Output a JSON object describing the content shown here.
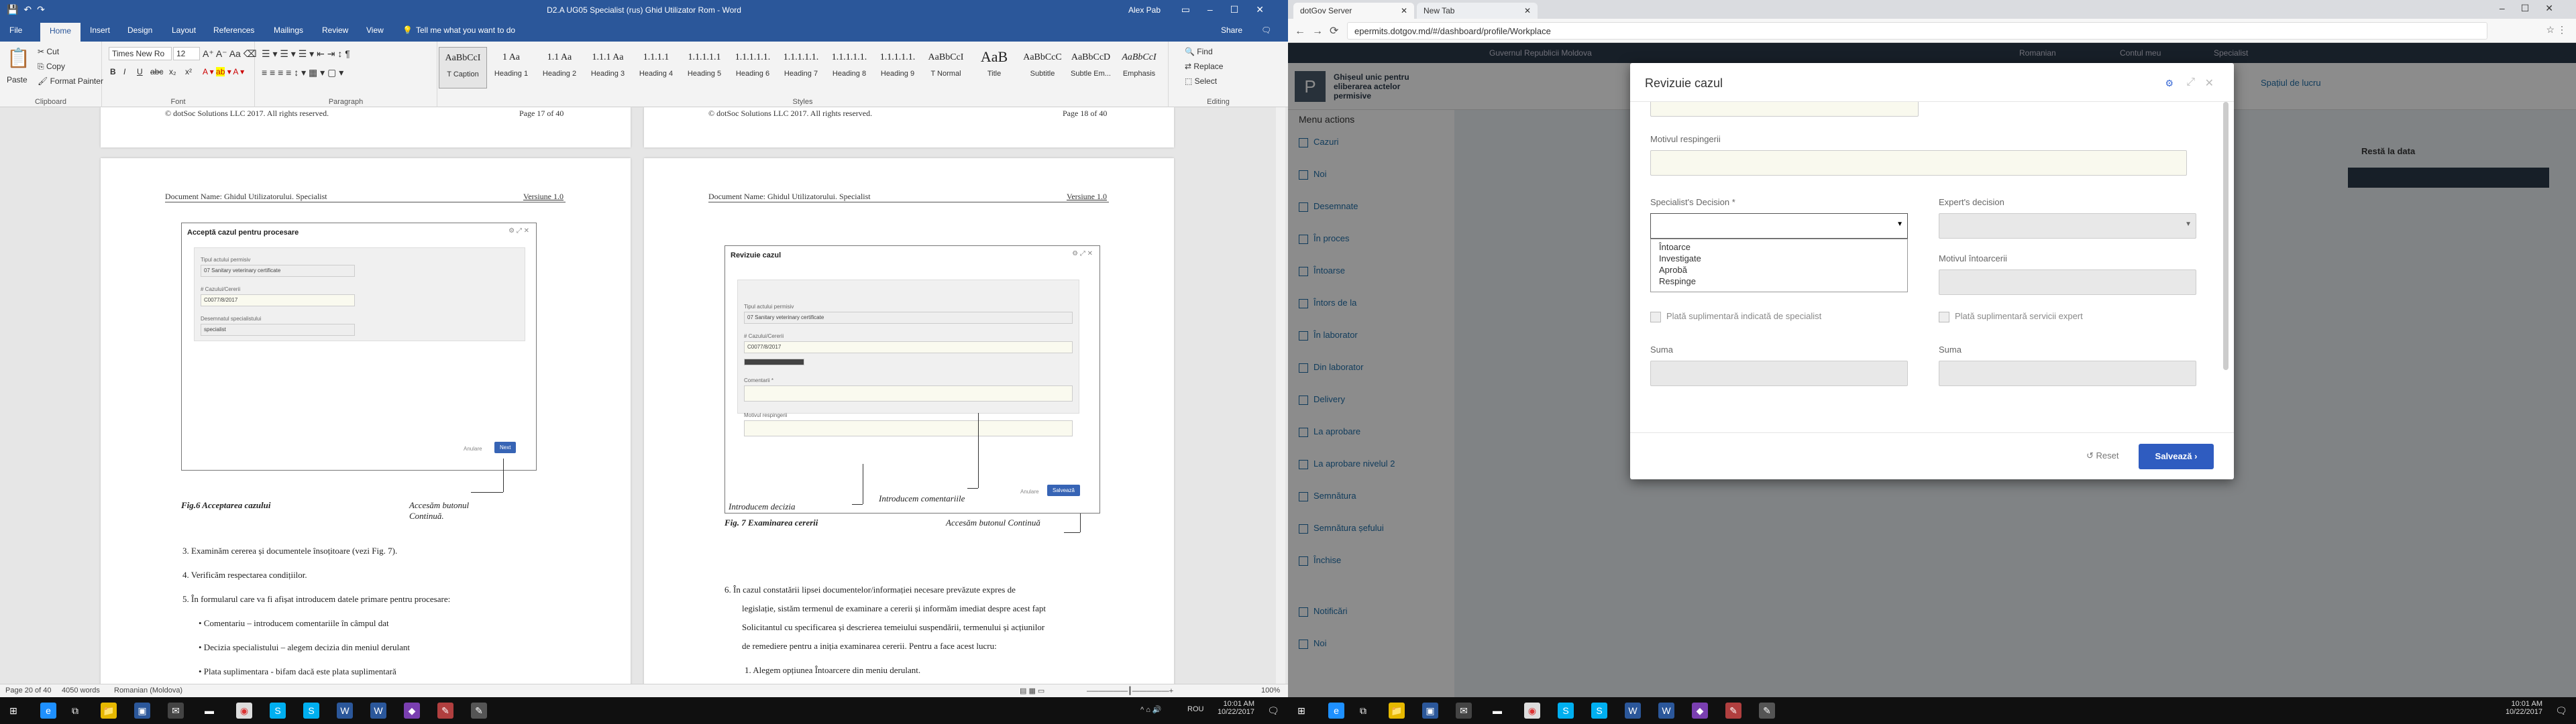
{
  "word": {
    "title": "D2.A UG05 Specialist (rus) Ghid Utilizator Rom  -  Word",
    "user": "Alex Pab",
    "tabs": [
      "File",
      "Home",
      "Insert",
      "Design",
      "Layout",
      "References",
      "Mailings",
      "Review",
      "View"
    ],
    "tell_me": "Tell me what you want to do",
    "share": "Share",
    "clipboard": {
      "paste": "Paste",
      "cut": "Cut",
      "copy": "Copy",
      "format_painter": "Format Painter",
      "label": "Clipboard"
    },
    "font": {
      "name": "Times New Ro",
      "size": "12",
      "label": "Font",
      "bold": "B",
      "italic": "I",
      "underline": "U",
      "strike": "abc",
      "sub": "x₂",
      "sup": "x²"
    },
    "paragraph_label": "Paragraph",
    "styles": [
      {
        "preview": "AaBbCcI",
        "name": "T Caption"
      },
      {
        "preview": "1 Aa",
        "name": "Heading 1"
      },
      {
        "preview": "1.1 Aa",
        "name": "Heading 2"
      },
      {
        "preview": "1.1.1 Aa",
        "name": "Heading 3"
      },
      {
        "preview": "1.1.1.1",
        "name": "Heading 4"
      },
      {
        "preview": "1.1.1.1.1",
        "name": "Heading 5"
      },
      {
        "preview": "1.1.1.1.1.",
        "name": "Heading 6"
      },
      {
        "preview": "1.1.1.1.1.",
        "name": "Heading 7"
      },
      {
        "preview": "1.1.1.1.1.",
        "name": "Heading 8"
      },
      {
        "preview": "1.1.1.1.1.",
        "name": "Heading 9"
      },
      {
        "preview": "AaBbCcI",
        "name": "T Normal"
      },
      {
        "preview": "AaB",
        "name": "Title"
      },
      {
        "preview": "AaBbCcC",
        "name": "Subtitle"
      },
      {
        "preview": "AaBbCcD",
        "name": "Subtle Em..."
      },
      {
        "preview": "AaBbCcI",
        "name": "Emphasis"
      }
    ],
    "styles_label": "Styles",
    "editing": {
      "find": "Find",
      "replace": "Replace",
      "select": "Select",
      "label": "Editing"
    },
    "page1": {
      "top_footer": "© dotSoc Solutions LLC 2017. All rights reserved.",
      "top_page": "Page 17 of 40",
      "doc_name": "Document Name: Ghidul Utilizatorului. Specialist",
      "version": "Versiune 1.0",
      "fig_title": "Acceptă cazul pentru procesare",
      "fig_f1_label": "Tipul actului permisiv",
      "fig_f1": "07 Sanitary veterinary certificate",
      "fig_f2_label": "# Cazului/Cererii",
      "fig_f2": "C0077/8/2017",
      "fig_f3_label": "Desemnatul specialistului",
      "fig_f3": "specialist",
      "fig_cancel": "Anulare",
      "fig_next": "Next",
      "caption": "Fig.6 Acceptarea cazului",
      "callout": "Accesăm butonul Continuă.",
      "items": [
        "3.   Examinăm cererea și documentele însoțitoare (vezi Fig. 7).",
        "4.   Verificăm respectarea condițiilor.",
        "5.   În formularul care va fi afișat introducem datele primare pentru procesare:",
        "•    Comentariu – introducem comentariile în câmpul dat",
        "•    Decizia specialistului – alegem decizia din meniul derulant",
        "•    Plata suplimentara  - bifam dacă este plata suplimentară"
      ]
    },
    "page2": {
      "top_footer": "© dotSoc Solutions LLC 2017. All rights reserved.",
      "top_page": "Page 18 of 40",
      "doc_name": "Document Name: Ghidul Utilizatorului. Specialist",
      "version": "Versiune 1.0",
      "fig_title": "Revizuie cazul",
      "fig_f1_label": "Tipul actului permisiv",
      "fig_f1": "07 Sanitary veterinary certificate",
      "fig_f2_label": "# Cazului/Cererii",
      "fig_f2": "C0077/8/2017",
      "fig_f3_label": "Comentarii *",
      "fig_f4_label": "Motivul respingerii",
      "fig_cancel": "Anulare",
      "fig_save": "Salvează",
      "callout_decision": "Introducem decizia",
      "callout_comments": "Introducem comentariile",
      "caption": "Fig. 7 Examinarea cererii",
      "callout_button": "Accesăm butonul Continuă",
      "item6": [
        "6.   În cazul constatării lipsei documentelor/informației necesare prevăzute expres de",
        "legislație, sistăm termenul de examinare a cererii și informăm imediat despre acest fapt",
        "Solicitantul cu specificarea și descrierea temeiului suspendării, termenului și acțiunilor",
        "de remediere pentru a iniția examinarea cererii. Pentru a face acest lucru:"
      ],
      "item6_1": "1.   Alegem opțiunea Întoarcere din meniu derulant."
    },
    "status": {
      "page": "Page 20 of 40",
      "words": "4050 words",
      "lang": "Romanian (Moldova)",
      "zoom": "100%"
    }
  },
  "browser": {
    "tabs": [
      "dotGov Server",
      "New Tab"
    ],
    "url": "epermits.dotgov.md/#/dashboard/profile/Workplace",
    "gov_banner": "Guvernul Republicii Moldova",
    "lang": "Romanian",
    "account": "Contul meu",
    "user": "Specialist",
    "app_title": "Ghișeul unic pentru eliberarea actelor permisive",
    "app_nav": "Spațiul de lucru",
    "menu_label": "Menu actions",
    "menu": [
      "Cazuri",
      "Noi",
      "Desemnate",
      "În proces",
      "Întoarse",
      "Întors de la",
      "În laborator",
      "Din laborator",
      "Delivery",
      "La aprobare",
      "La aprobare nivelul 2",
      "Semnătura",
      "Semnătura șefului",
      "Închise",
      "Notificări",
      "Noi"
    ],
    "right_hint": "Restă la data",
    "modal": {
      "title": "Revizuie cazul",
      "reject_label": "Motivul respingerii",
      "spec_decision_label": "Specialist's Decision *",
      "expert_decision_label": "Expert's decision",
      "return_reason_label": "Motivul întoarcerii",
      "options": [
        "Întoarce",
        "Investigate",
        "Aprobă",
        "Respinge"
      ],
      "chk_spec": "Plată suplimentară indicată de specialist",
      "chk_expert": "Plată suplimentară servicii expert",
      "sum1": "Suma",
      "sum2": "Suma",
      "reset": "Reset",
      "save": "Salvează"
    }
  },
  "taskbar": {
    "left_clock": {
      "time": "10:01 AM",
      "date": "10/22/2017",
      "lang": "ROU"
    },
    "right_clock": {
      "time": "10:01 AM",
      "date": "10/22/2017"
    }
  }
}
